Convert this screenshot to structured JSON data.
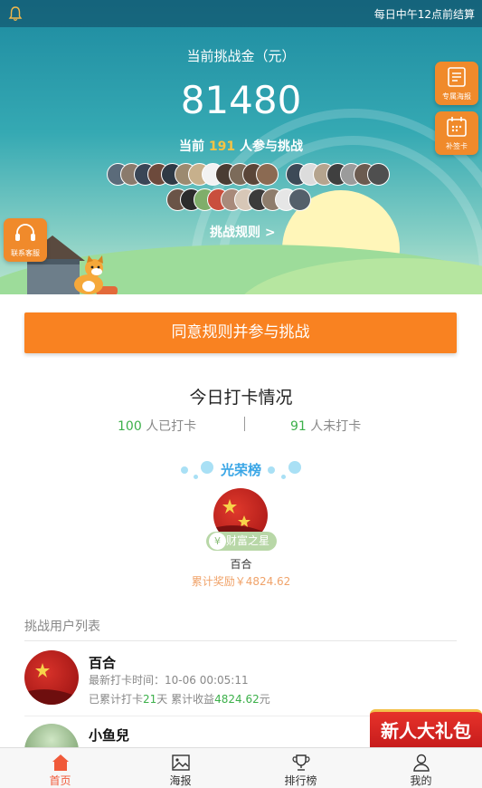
{
  "topbar": {
    "notice": "每日中午12点前结算",
    "icon": "bell-icon"
  },
  "hero": {
    "amount_label": "当前挑战金（元）",
    "amount": "81480",
    "participants_prefix": "当前",
    "participants_count": "191",
    "participants_suffix": "人参与挑战",
    "rules_link": "挑战规则 >",
    "side_buttons": [
      {
        "label": "专属海报",
        "icon": "poster-icon"
      },
      {
        "label": "补签卡",
        "icon": "calendar-icon"
      }
    ],
    "contact_button": {
      "label": "联系客服",
      "icon": "headset-icon"
    }
  },
  "cta": {
    "label": "同意规则并参与挑战"
  },
  "today": {
    "title": "今日打卡情况",
    "checked_count": "100",
    "checked_label": "人已打卡",
    "unchecked_count": "91",
    "unchecked_label": "人未打卡"
  },
  "honor": {
    "title": "光荣榜",
    "badge": "财富之星",
    "badge_icon": "¥",
    "name": "百合",
    "reward": "累计奖励￥4824.62"
  },
  "list": {
    "title": "挑战用户列表",
    "users": [
      {
        "name": "百合",
        "last_label": "最新打卡时间：",
        "last_time": "10-06 00:05:11",
        "days_prefix": "已累计打卡",
        "days": "21",
        "days_unit": "天",
        "earn_prefix": "累计收益",
        "earn": "4824.62",
        "earn_unit": "元"
      },
      {
        "name": "小鱼兒"
      }
    ]
  },
  "promo": {
    "label": "新人大礼包"
  },
  "tabbar": {
    "items": [
      {
        "label": "首页",
        "icon": "home-icon",
        "active": true
      },
      {
        "label": "海报",
        "icon": "image-icon",
        "active": false
      },
      {
        "label": "排行榜",
        "icon": "trophy-icon",
        "active": false
      },
      {
        "label": "我的",
        "icon": "user-icon",
        "active": false
      }
    ]
  },
  "colors": {
    "accent": "#f98221",
    "success": "#3cb04a",
    "honor": "#3aa6e6",
    "active_tab": "#f05a3a"
  }
}
